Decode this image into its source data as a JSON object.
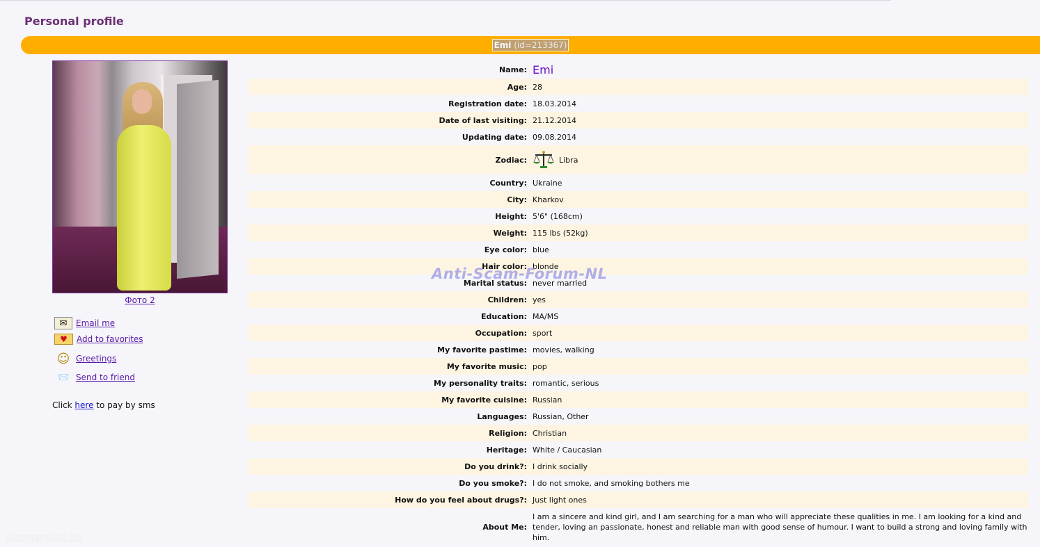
{
  "page_title": "Personal profile",
  "banner": {
    "name": "Emi",
    "id_text": "(id=213367)"
  },
  "photo": {
    "link_label": "Фото 2"
  },
  "actions": [
    {
      "label": "Email me",
      "icon": "envelope-icon"
    },
    {
      "label": "Add to favorites",
      "icon": "heart-icon"
    },
    {
      "label": "Greetings",
      "icon": "smiley-icon"
    },
    {
      "label": "Send to friend",
      "icon": "send-to-friend-icon"
    }
  ],
  "sms": {
    "prefix": "Click",
    "link": "here",
    "suffix": "to pay by sms"
  },
  "profile": {
    "name": {
      "label": "Name:",
      "value": "Emi"
    },
    "age": {
      "label": "Age:",
      "value": "28"
    },
    "registration_date": {
      "label": "Registration date:",
      "value": "18.03.2014"
    },
    "last_visit": {
      "label": "Date of last visiting:",
      "value": "21.12.2014"
    },
    "updating_date": {
      "label": "Updating date:",
      "value": "09.08.2014"
    },
    "zodiac": {
      "label": "Zodiac:",
      "value": "Libra",
      "icon": "libra-scales-icon"
    },
    "country": {
      "label": "Country:",
      "value": "Ukraine"
    },
    "city": {
      "label": "City:",
      "value": "Kharkov"
    },
    "height": {
      "label": "Height:",
      "value": "5'6\" (168cm)"
    },
    "weight": {
      "label": "Weight:",
      "value": "115 lbs (52kg)"
    },
    "eye_color": {
      "label": "Eye color:",
      "value": "blue"
    },
    "hair_color": {
      "label": "Hair color:",
      "value": "blonde"
    },
    "marital_status": {
      "label": "Marital status:",
      "value": "never married"
    },
    "children": {
      "label": "Children:",
      "value": "yes"
    },
    "education": {
      "label": "Education:",
      "value": "MA/MS"
    },
    "occupation": {
      "label": "Occupation:",
      "value": "sport"
    },
    "pastime": {
      "label": "My favorite pastime:",
      "value": "movies, walking"
    },
    "music": {
      "label": "My favorite music:",
      "value": "pop"
    },
    "personality": {
      "label": "My personality traits:",
      "value": "romantic, serious"
    },
    "cuisine": {
      "label": "My favorite cuisine:",
      "value": "Russian"
    },
    "languages": {
      "label": "Languages:",
      "value": "Russian, Other"
    },
    "religion": {
      "label": "Religion:",
      "value": "Christian"
    },
    "heritage": {
      "label": "Heritage:",
      "value": "White / Caucasian"
    },
    "drink": {
      "label": "Do you drink?:",
      "value": "I drink socially"
    },
    "smoke": {
      "label": "Do you smoke?:",
      "value": "I do not smoke, and smoking bothers me"
    },
    "drugs": {
      "label": "How do you feel about drugs?:",
      "value": "Just light ones"
    },
    "about": {
      "label": "About Me:",
      "value": "I am a sincere and kind girl, and I am searching for a man who will appreciate these qualities in me. I am looking for a kind and tender, loving an passionate, honest and reliable man with good sense of humour. I want to build a strong and loving family with him."
    }
  },
  "watermarks": {
    "center": "Anti-Scam-Forum-NL",
    "footer": "Scamerslist.de"
  },
  "colors": {
    "banner": "#ffae00",
    "title": "#6b2f73",
    "link": "#5a1aa8",
    "row_alt": "#fdf5e2",
    "name": "#6a0fc9"
  }
}
